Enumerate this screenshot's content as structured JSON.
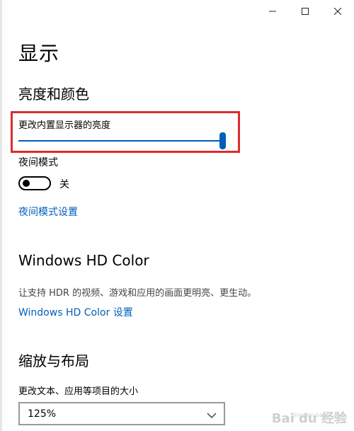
{
  "window": {
    "minimize_icon": "minimize-icon",
    "maximize_icon": "maximize-icon",
    "close_icon": "close-icon"
  },
  "page_title": "显示",
  "brightness_section": {
    "heading": "亮度和颜色",
    "slider_label": "更改内置显示器的亮度",
    "slider_value": 1.0,
    "highlight_color": "#e02b2b"
  },
  "night_mode": {
    "label": "夜间模式",
    "toggle_state": "关",
    "toggle_on": false,
    "settings_link": "夜间模式设置"
  },
  "hd_color": {
    "heading": "Windows HD Color",
    "description": "让支持 HDR 的视频、游戏和应用的画面更明亮、更生动。",
    "settings_link": "Windows HD Color 设置"
  },
  "scale_layout": {
    "heading": "缩放与布局",
    "label": "更改文本、应用等项目的大小",
    "selected_value": "125%"
  },
  "watermark": {
    "text": "Bai du 经验",
    "url": "jingyan.baidu.com"
  },
  "colors": {
    "accent": "#005fb8",
    "link": "#005fb8"
  }
}
